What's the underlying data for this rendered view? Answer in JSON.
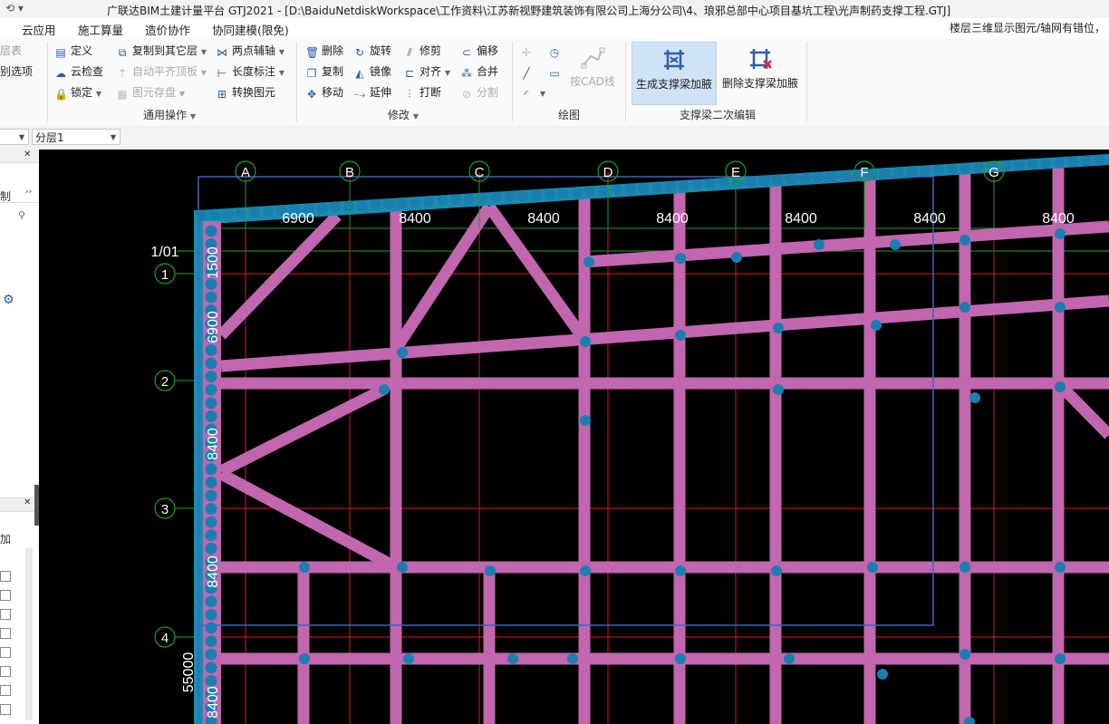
{
  "titlebar": {
    "title": "广联达BIM土建计量平台 GTJ2021 - [D:\\BaiduNetdiskWorkspace\\工作资料\\江苏新视野建筑装饰有限公司上海分公司\\4、琅邪总部中心项目基坑工程\\光声制药支撑工程.GTJ]",
    "quick_access": "⟲ ▾"
  },
  "menu": {
    "items": [
      "云应用",
      "施工算量",
      "造价协作",
      "协同建模(限免)"
    ],
    "notice": "楼层三维显示图元/轴网有错位，"
  },
  "ribbon": {
    "left_partial": [
      "层表",
      "别选项"
    ],
    "general": {
      "define": "定义",
      "copy_to_floor": "复制到其它层",
      "two_point_axis": "两点辅轴",
      "cloud_check": "云检查",
      "auto_align_slab": "自动平齐顶板",
      "length_dim": "长度标注",
      "lock": "锁定",
      "element_save": "图元存盘",
      "convert_element": "转换图元",
      "group": "通用操作"
    },
    "modify": {
      "delete": "删除",
      "rotate": "旋转",
      "trim": "修剪",
      "offset": "偏移",
      "copy": "复制",
      "mirror": "镜像",
      "align": "对齐",
      "merge": "合并",
      "move": "移动",
      "extend": "延伸",
      "break": "打断",
      "split": "分割",
      "group": "修改"
    },
    "draw": {
      "cad_line": "按CAD线",
      "group": "绘图"
    },
    "strut_edit": {
      "generate": "生成支撑梁加腋",
      "remove": "删除支撑梁加腋",
      "group": "支撑梁二次编辑"
    }
  },
  "toolbar2": {
    "layer_select": "分层1"
  },
  "left_panel": {
    "tab_partial": "制",
    "checkbox_header": "加"
  },
  "canvas": {
    "columns": [
      {
        "label": "A",
        "span": "6900"
      },
      {
        "label": "B",
        "span": "8400"
      },
      {
        "label": "C",
        "span": "8400"
      },
      {
        "label": "D",
        "span": "8400"
      },
      {
        "label": "E",
        "span": "8400"
      },
      {
        "label": "F",
        "span": "8400"
      },
      {
        "label": "G",
        "span": "8400"
      }
    ],
    "rows": [
      "1/01",
      "1",
      "2",
      "3",
      "4"
    ],
    "row_dims": [
      "1500",
      "6900",
      "8400",
      "8400"
    ],
    "bottom_dims": [
      "8400"
    ],
    "total_dim": "55000",
    "colors": {
      "background": "#000000",
      "beam": "#c266b0",
      "crown_beam": "#1a8cb0",
      "pile": "#1a7fb0",
      "axis_red": "#d81e1e",
      "axis_green": "#1fa01f",
      "boundary": "#3f64b5"
    }
  }
}
